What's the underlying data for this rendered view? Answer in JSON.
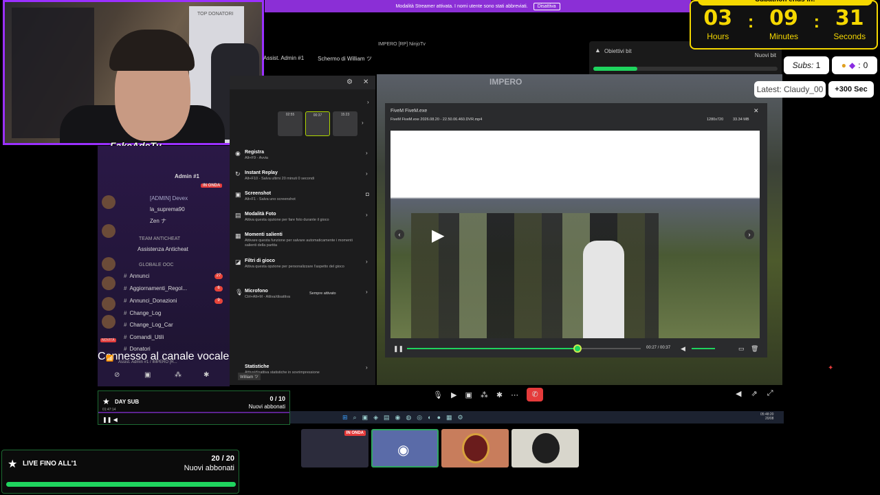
{
  "banner": {
    "text": "Modalità Streamer attivata. I nomi utente sono stati abbreviati.",
    "button": "Disattiva"
  },
  "webcam": {
    "streamer_name": "FakeAdeTv",
    "board_text": "TOP DONATORI"
  },
  "subathon": {
    "header": "Subathon ends in:",
    "hours": "03",
    "minutes": "09",
    "seconds": "31",
    "hours_label": "Hours",
    "minutes_label": "Minutes",
    "seconds_label": "Seconds",
    "accent_color": "#f5d800"
  },
  "bits_goal": {
    "title": "Obiettivi bit",
    "new_label": "Nuovi bit",
    "progress_fraction": 0.24
  },
  "subs": {
    "label": "Subs:",
    "count": "1"
  },
  "bits": {
    "count": "0"
  },
  "latest": "Latest: Claudy_00",
  "bonus": "+300 Sec",
  "share": {
    "title": "IMPERO [RP] NinjoTv",
    "tab1": "Assist. Admin #1",
    "tab2": "Schermo di William ツ",
    "game_watermark": "IMPERO"
  },
  "discord": {
    "admin_label": "Admin #1",
    "live_badge": "IN ONDA",
    "users": [
      "[ADMIN] Devex",
      "la_suprema90",
      "Zen ナ"
    ],
    "category1": "TEAM ANTICHEAT",
    "channel_anticheat": "Assistenza Anticheat",
    "category2": "GLOBALE OOC",
    "channels": [
      "Annunci",
      "Aggiornamenti_Regol...",
      "Annunci_Donazioni",
      "Change_Log",
      "Change_Log_Car",
      "Comandi_Utili",
      "Donatori"
    ],
    "badges": [
      "27",
      "6",
      "9"
    ],
    "voice_connected": "Connesso al canale vocale",
    "voice_channel": "Assist. Admin #1 / IMPERO [R...",
    "user_name": "William ツ",
    "new_label": "NOVITÀ"
  },
  "settings": {
    "clips": [
      "02:55",
      "00:37",
      "15:23"
    ],
    "items": [
      {
        "title": "Registra",
        "desc": "Alt+F9 - Avvia"
      },
      {
        "title": "Instant Replay",
        "desc": "Alt+F10 - Salva ultimi 20 minuti 0 secondi"
      },
      {
        "title": "Screenshot",
        "desc": "Alt+F1 - Salva uno screenshot"
      },
      {
        "title": "Modalità Foto",
        "desc": "Attiva questa opzione per fare foto durante il gioco"
      },
      {
        "title": "Momenti salienti",
        "desc": "Attivare questa funzione per salvare automaticamente i momenti salienti della partita"
      },
      {
        "title": "Filtri di gioco",
        "desc": "Attiva questa opzione per personalizzare l'aspetto del gioco"
      },
      {
        "title": "Microfono",
        "desc": "Ctrl+Alt+M - Attiva/disattiva",
        "value": "Sempre attivato"
      },
      {
        "title": "Statistiche",
        "desc": "Attiva/disattiva statistiche in sovrimpressione"
      }
    ]
  },
  "player": {
    "app_title": "FiveM FiveM.exe",
    "file_name": "FiveM FiveM.exe 2026.08.20 - 22.50.06.460.DVR.mp4",
    "resolution": "1280x720",
    "size": "33.34 MB",
    "time": "00:27 / 00:37",
    "progress_fraction": 0.73
  },
  "taskbar": {
    "time": "05:48:20",
    "date": "20/08"
  },
  "thumbs": {
    "live_badge": "IN ONDA"
  },
  "day_sub": {
    "title": "DAY SUB",
    "subtitle": "01:47:14",
    "count": "0 / 10",
    "label": "Nuovi abbonati",
    "progress_fraction": 0.0
  },
  "live_goal": {
    "title": "LIVE FINO ALL'1",
    "count": "20 / 20",
    "label": "Nuovi abbonati",
    "progress_fraction": 1.0
  }
}
